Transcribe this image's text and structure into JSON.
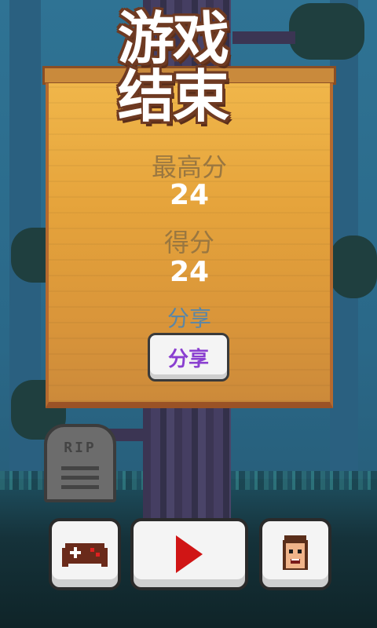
{
  "game_over": {
    "title_line1": "游戏",
    "title_line2": "结束",
    "best_label": "最高分",
    "best_value": "24",
    "score_label": "得分",
    "score_value": "24",
    "share_label": "分享",
    "share_button": "分享"
  },
  "scene": {
    "tombstone_text": "RIP"
  },
  "controls": {
    "games_icon": "gamepad-icon",
    "play_icon": "play-icon",
    "character_icon": "character-face-icon"
  },
  "colors": {
    "board": "#e5a33b",
    "title_text": "#ffffff",
    "title_outline": "#6e3a22",
    "score_value": "#ffffff",
    "label": "#9a7740",
    "share_label": "#5a86a6",
    "share_button_text": "#8a3fd0",
    "play_icon": "#d01515"
  }
}
